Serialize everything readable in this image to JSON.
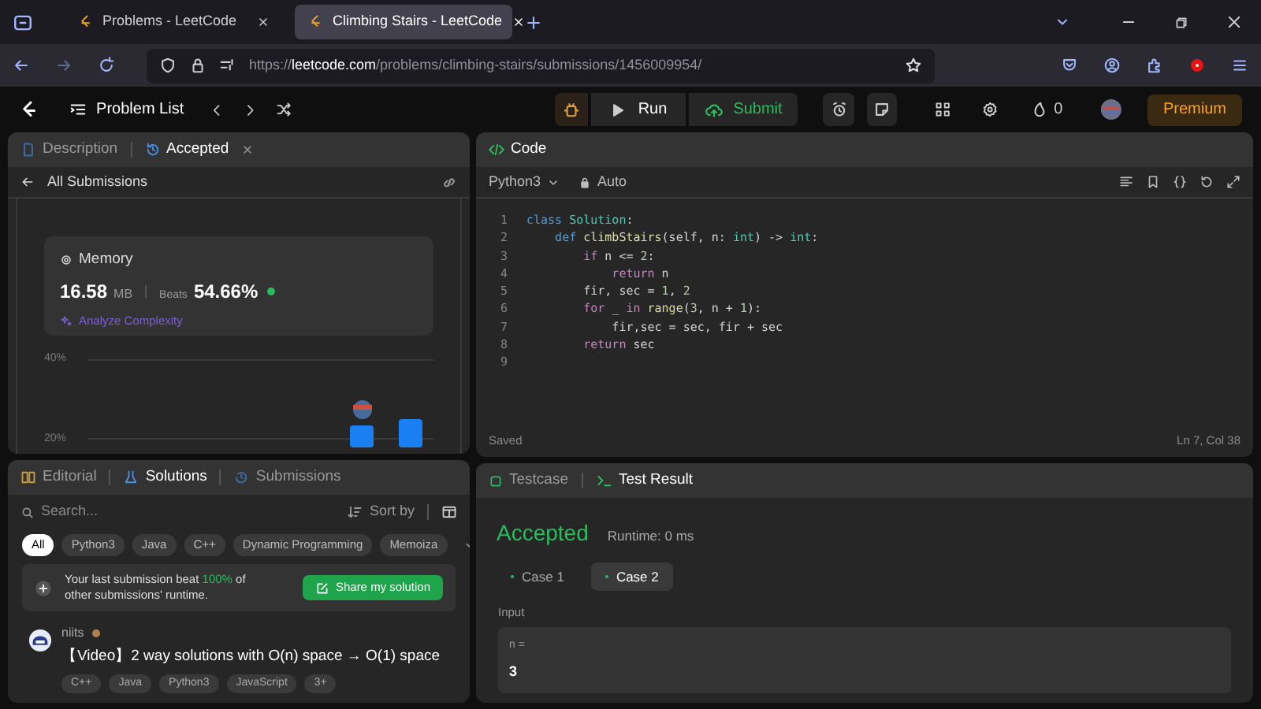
{
  "browser": {
    "tabs": [
      {
        "title": "Problems - LeetCode",
        "selected": false
      },
      {
        "title": "Climbing Stairs - LeetCode",
        "selected": true
      }
    ],
    "url": {
      "scheme": "https://",
      "domain": "leetcode.com",
      "path": "/problems/climbing-stairs/submissions/1456009954/"
    }
  },
  "nav": {
    "problem_list": "Problem List",
    "run": "Run",
    "submit": "Submit",
    "streak": "0",
    "premium": "Premium"
  },
  "description_panel": {
    "tabs": [
      {
        "label": "Description",
        "selected": false
      },
      {
        "label": "Accepted",
        "selected": true
      }
    ],
    "back_link": "All Submissions",
    "memory": {
      "title": "Memory",
      "value": "16.58",
      "unit": "MB",
      "beats_label": "Beats",
      "beats": "54.66%",
      "analyze": "Analyze Complexity"
    },
    "chart_ticks": [
      "40%",
      "20%"
    ]
  },
  "code_panel": {
    "title": "Code",
    "language": "Python3",
    "mode": "Auto",
    "lines": [
      {
        "number": "1",
        "tokens": [
          {
            "text": "class ",
            "kind": "keyword"
          },
          {
            "text": "Solution",
            "kind": "class"
          },
          {
            "text": ":",
            "kind": "plain"
          }
        ]
      },
      {
        "number": "2",
        "tokens": [
          {
            "text": "    def ",
            "kind": "keyword"
          },
          {
            "text": "climbStairs",
            "kind": "func"
          },
          {
            "text": "(self, n: ",
            "kind": "plain"
          },
          {
            "text": "int",
            "kind": "class"
          },
          {
            "text": ") -> ",
            "kind": "plain"
          },
          {
            "text": "int",
            "kind": "class"
          },
          {
            "text": ":",
            "kind": "plain"
          }
        ]
      },
      {
        "number": "3",
        "tokens": [
          {
            "text": "        if ",
            "kind": "control"
          },
          {
            "text": "n <= ",
            "kind": "plain"
          },
          {
            "text": "2",
            "kind": "number"
          },
          {
            "text": ":",
            "kind": "plain"
          }
        ]
      },
      {
        "number": "4",
        "tokens": [
          {
            "text": "            return ",
            "kind": "control"
          },
          {
            "text": "n",
            "kind": "plain"
          }
        ]
      },
      {
        "number": "5",
        "tokens": [
          {
            "text": "        fir, sec = ",
            "kind": "plain"
          },
          {
            "text": "1",
            "kind": "number"
          },
          {
            "text": ", ",
            "kind": "plain"
          },
          {
            "text": "2",
            "kind": "number"
          }
        ]
      },
      {
        "number": "6",
        "tokens": [
          {
            "text": "        for ",
            "kind": "control"
          },
          {
            "text": "_ ",
            "kind": "plain"
          },
          {
            "text": "in ",
            "kind": "control"
          },
          {
            "text": "range",
            "kind": "func"
          },
          {
            "text": "(",
            "kind": "plain"
          },
          {
            "text": "3",
            "kind": "number"
          },
          {
            "text": ", n + ",
            "kind": "plain"
          },
          {
            "text": "1",
            "kind": "number"
          },
          {
            "text": "):",
            "kind": "plain"
          }
        ]
      },
      {
        "number": "7",
        "tokens": [
          {
            "text": "            fir,sec = sec, fir + sec",
            "kind": "plain"
          }
        ]
      },
      {
        "number": "8",
        "tokens": [
          {
            "text": "        return ",
            "kind": "control"
          },
          {
            "text": "sec",
            "kind": "plain"
          }
        ]
      },
      {
        "number": "9"
      }
    ],
    "status": "Saved",
    "cursor": "Ln 7, Col 38"
  },
  "solutions_panel": {
    "tabs": [
      {
        "label": "Editorial",
        "selected": false
      },
      {
        "label": "Solutions",
        "selected": true
      },
      {
        "label": "Submissions",
        "selected": false
      }
    ],
    "search_placeholder": "Search...",
    "sort": "Sort by",
    "filters": [
      {
        "label": "All",
        "selected": true
      },
      {
        "label": "Python3",
        "selected": false
      },
      {
        "label": "Java",
        "selected": false
      },
      {
        "label": "C++",
        "selected": false
      },
      {
        "label": "Dynamic Programming",
        "selected": false
      },
      {
        "label": "Memoiza",
        "selected": false
      }
    ],
    "banner": {
      "before": "Your last submission beat ",
      "highlight": "100%",
      "after": " of other submissions' runtime.",
      "button": "Share my solution"
    },
    "solution": {
      "author": "niits",
      "title": "【Video】2 way solutions with O(n) space → O(1) space",
      "tags": [
        "C++",
        "Java",
        "Python3",
        "JavaScript",
        "3+"
      ]
    }
  },
  "result_panel": {
    "tabs": [
      {
        "label": "Testcase",
        "selected": false
      },
      {
        "label": "Test Result",
        "selected": true
      }
    ],
    "status": "Accepted",
    "runtime": "Runtime: 0 ms",
    "cases": [
      {
        "label": "Case 1",
        "selected": false
      },
      {
        "label": "Case 2",
        "selected": true
      }
    ],
    "input_label": "Input",
    "param_name": "n =",
    "param_value": "3"
  }
}
